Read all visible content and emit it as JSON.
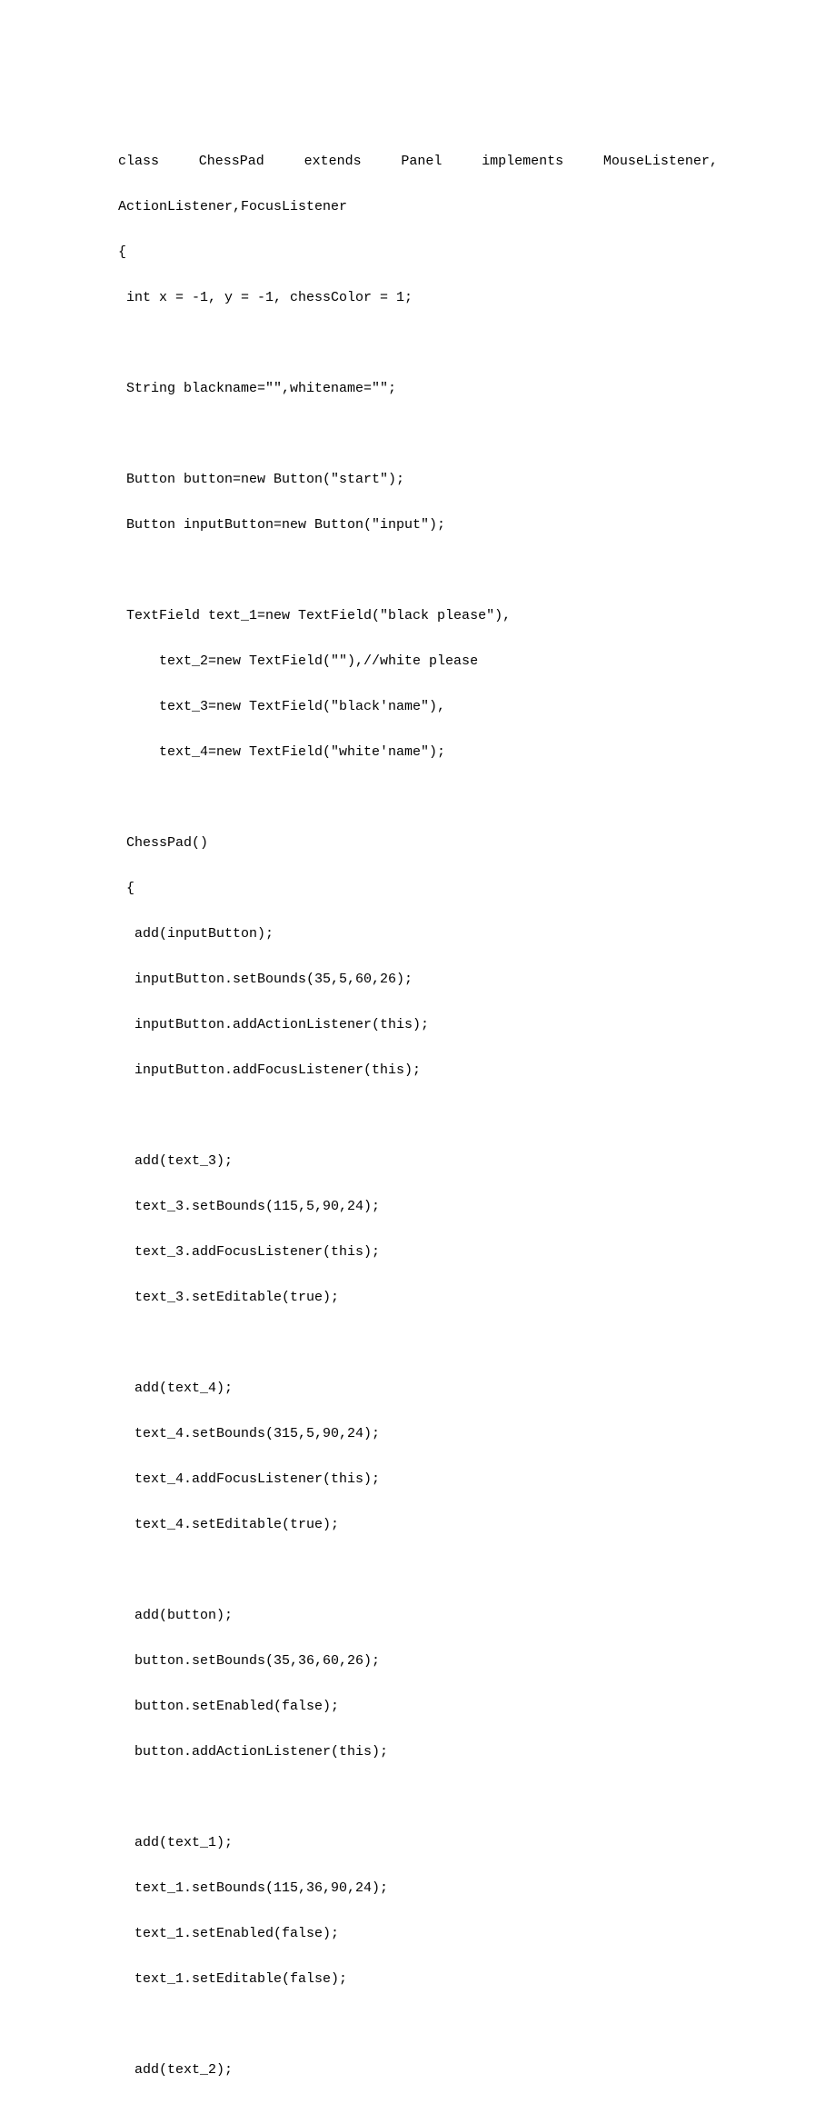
{
  "lines": {
    "l1_words": [
      "class",
      "ChessPad",
      "extends",
      "Panel",
      "implements",
      "MouseListener,"
    ],
    "l2": "ActionListener,FocusListener",
    "l3": "{",
    "l4": " int x = -1, y = -1, chessColor = 1;",
    "l5": " String blackname=\"\",whitename=\"\";",
    "l6": " Button button=new Button(\"start\");",
    "l7": " Button inputButton=new Button(\"input\");",
    "l8": " TextField text_1=new TextField(\"black please\"),",
    "l9": "     text_2=new TextField(\"\"),//white please",
    "l10": "     text_3=new TextField(\"black'name\"),",
    "l11": "     text_4=new TextField(\"white'name\");",
    "l12": " ChessPad()",
    "l13": " {",
    "l14": "  add(inputButton);",
    "l15": "  inputButton.setBounds(35,5,60,26);",
    "l16": "  inputButton.addActionListener(this);",
    "l17": "  inputButton.addFocusListener(this);",
    "l18": "  add(text_3);",
    "l19": "  text_3.setBounds(115,5,90,24);",
    "l20": "  text_3.addFocusListener(this);",
    "l21": "  text_3.setEditable(true);",
    "l22": "  add(text_4);",
    "l23": "  text_4.setBounds(315,5,90,24);",
    "l24": "  text_4.addFocusListener(this);",
    "l25": "  text_4.setEditable(true);",
    "l26": "  add(button);",
    "l27": "  button.setBounds(35,36,60,26);",
    "l28": "  button.setEnabled(false);",
    "l29": "  button.addActionListener(this);",
    "l30": "  add(text_1);",
    "l31": "  text_1.setBounds(115,36,90,24);",
    "l32": "  text_1.setEnabled(false);",
    "l33": "  text_1.setEditable(false);",
    "l34": "  add(text_2);"
  }
}
